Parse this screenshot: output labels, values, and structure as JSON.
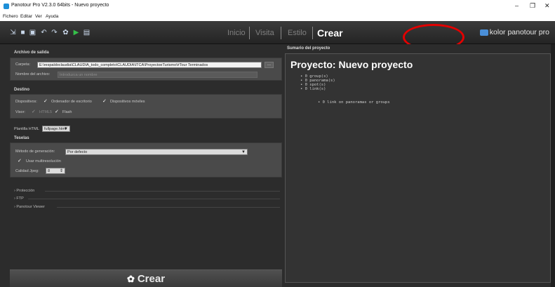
{
  "window": {
    "title": "Panotour Pro V2.3.0 64bits - Nuevo proyecto",
    "controls": [
      "–",
      "❐",
      "✕"
    ]
  },
  "menu": [
    "Fichero",
    "Editar",
    "Ver",
    "Ayuda"
  ],
  "toolbar": {
    "icons": [
      "import-icon",
      "save-icon",
      "save-as-icon",
      "undo-icon",
      "redo-icon",
      "settings-icon",
      "play-icon",
      "image-icon"
    ],
    "tabs": [
      "Inicio",
      "Visita",
      "Estilo",
      "Crear"
    ],
    "active_tab": "Crear",
    "brand": "kolor panotour pro"
  },
  "output": {
    "heading": "Archivo de salida",
    "folder_label": "Carpeta:",
    "folder_value": "E:\\respaldoclaudia\\CLAUDIA_todo_completo\\CLAUDIA\\ITCA\\ProyectoeTurismo\\#Tour Terminados",
    "browse_label": "...",
    "filename_label": "Nombre del archivo:",
    "filename_placeholder": "Introduzca un nombre"
  },
  "destino": {
    "heading": "Destino",
    "devices_label": "Dispositivos:",
    "desktop_label": "Ordenador de escritorio",
    "mobile_label": "Dispositivos móviles",
    "viewer_label": "Visor:",
    "html5_label": "HTML5",
    "flash_label": "Flash"
  },
  "template": {
    "label": "Plantilla HTML",
    "value": "fullpage.html"
  },
  "teselas": {
    "heading": "Teselas",
    "method_label": "Método de generación:",
    "method_value": "Por defecto",
    "multires_label": "Usar multiresolución",
    "quality_label": "Calidad Jpeg:",
    "quality_value": "8"
  },
  "collapsibles": [
    "Protección",
    "FTP",
    "Panotour Viewer"
  ],
  "create_button": "Crear",
  "summary": {
    "heading": "Sumario del proyecto",
    "title": "Proyecto: Nuevo proyecto",
    "stats": [
      "0 group(s)",
      "0 panorama(s)",
      "0 spot(s)",
      "0 link(s)"
    ],
    "note": "0 link on panoramas or groups"
  }
}
